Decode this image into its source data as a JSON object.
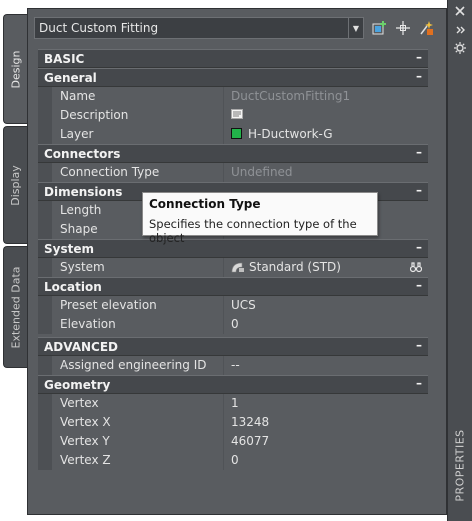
{
  "window": {
    "title": "PROPERTIES",
    "side_tabs": [
      "Design",
      "Display",
      "Extended Data"
    ]
  },
  "selector": {
    "value": "Duct Custom Fitting"
  },
  "sections": {
    "basic": "BASIC",
    "general": "General",
    "connectors": "Connectors",
    "dimensions": "Dimensions",
    "system": "System",
    "location": "Location",
    "advanced": "ADVANCED",
    "geometry": "Geometry"
  },
  "props": {
    "name": {
      "label": "Name",
      "value": "DuctCustomFitting1"
    },
    "description": {
      "label": "Description",
      "value": ""
    },
    "layer": {
      "label": "Layer",
      "value": "H-Ductwork-G",
      "swatch": "#22b34a"
    },
    "connection_type": {
      "label": "Connection Type",
      "value": "Undefined"
    },
    "length": {
      "label": "Length",
      "value": ""
    },
    "shape": {
      "label": "Shape",
      "value": ""
    },
    "system": {
      "label": "System",
      "value": "Standard (STD)"
    },
    "preset_elevation": {
      "label": "Preset elevation",
      "value": "UCS"
    },
    "elevation": {
      "label": "Elevation",
      "value": "0"
    },
    "assigned_engineering_id": {
      "label": "Assigned engineering ID",
      "value": "--"
    },
    "vertex": {
      "label": "Vertex",
      "value": "1"
    },
    "vertex_x": {
      "label": "Vertex X",
      "value": "13248"
    },
    "vertex_y": {
      "label": "Vertex Y",
      "value": "46077"
    },
    "vertex_z": {
      "label": "Vertex Z",
      "value": "0"
    }
  },
  "collapse_symbol": "–",
  "tooltip": {
    "title": "Connection Type",
    "body": "Specifies the connection type of the object"
  }
}
